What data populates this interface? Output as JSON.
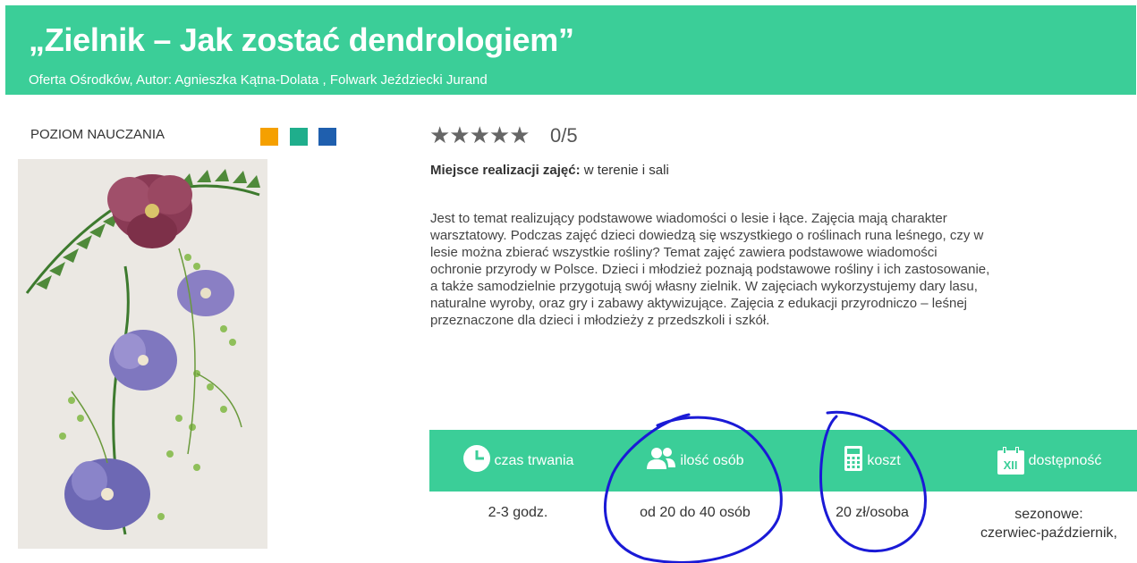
{
  "header": {
    "title": "„Zielnik – Jak zostać dendrologiem”",
    "subtitle": "Oferta Ośrodków, Autor: Agnieszka Kątna-Dolata , Folwark Jeździecki Jurand"
  },
  "level": {
    "label": "POZIOM NAUCZANIA",
    "colors": [
      "#f5a000",
      "#1fae8c",
      "#1f5fae"
    ]
  },
  "rating": {
    "stars": "★★★★★",
    "value": "0/5"
  },
  "place": {
    "label": "Miejsce realizacji zajęć:",
    "value": " w terenie i sali"
  },
  "description": [
    "Jest to temat realizujący podstawowe wiadomości o lesie i łące. Zajęcia mają charakter",
    "warsztatowy. Podczas zajęć dzieci dowiedzą się wszystkiego o roślinach runa leśnego, czy w",
    "lesie można zbierać wszystkie rośliny? Temat zajęć zawiera podstawowe wiadomości",
    "ochronie przyrody w Polsce. Dzieci i młodzież poznają podstawowe rośliny i ich zastosowanie,",
    "a także samodzielnie przygotują swój własny zielnik. W zajęciach wykorzystujemy dary lasu,",
    "naturalne wyroby, oraz gry i zabawy aktywizujące. Zajęcia z edukacji przyrodniczo – leśnej",
    "przeznaczone dla dzieci i młodzieży z przedszkoli i szkół."
  ],
  "info": {
    "duration": {
      "label": "czas trwania",
      "icon": "clock-icon",
      "value": "2-3 godz."
    },
    "people": {
      "label": "ilość osób",
      "icon": "people-icon",
      "value": "od 20 do 40 osób"
    },
    "cost": {
      "label": "koszt",
      "icon": "calculator-icon",
      "value": "20 zł/osoba"
    },
    "availability": {
      "label": "dostępność",
      "icon": "calendar-icon",
      "calendar_text": "XII",
      "value_line1": "sezonowe:",
      "value_line2": "czerwiec-październik,"
    }
  },
  "colors": {
    "accent": "#3bce98",
    "annotation": "#1a1ad6"
  }
}
